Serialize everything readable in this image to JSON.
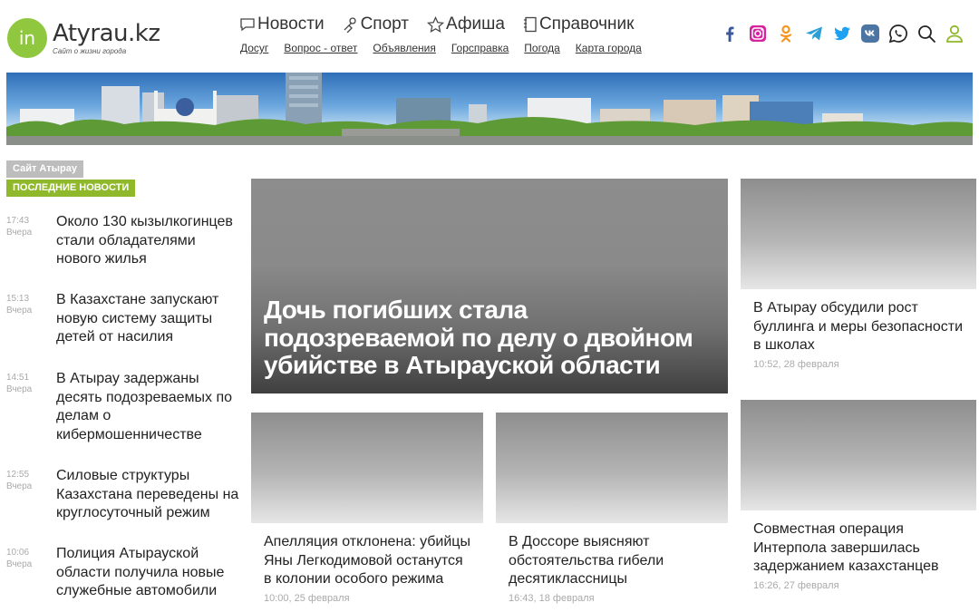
{
  "logo": {
    "mark": "in",
    "name": "Atyrau.kz",
    "tagline": "Сайт о жизни города"
  },
  "nav": {
    "main": [
      {
        "label": "Новости",
        "icon": "chat-bubble-icon"
      },
      {
        "label": "Спорт",
        "icon": "sport-icon"
      },
      {
        "label": "Афиша",
        "icon": "star-icon"
      },
      {
        "label": "Справочник",
        "icon": "notebook-icon"
      }
    ],
    "sub": [
      "Досуг",
      "Вопрос - ответ",
      "Объявления",
      "Горсправка",
      "Погода",
      "Карта города"
    ]
  },
  "social": {
    "colors": {
      "facebook": "#3b5998",
      "instagram": "#d6249f",
      "ok": "#f7931e",
      "telegram": "#2a9fd6",
      "twitter": "#1da1f2",
      "vk": "#4c75a3",
      "whatsapp": "#222222",
      "search": "#222222",
      "user": "#8fb82a"
    }
  },
  "sidebar": {
    "tag_site": "Сайт Атырау",
    "tag_latest": "ПОСЛЕДНИЕ НОВОСТИ",
    "items": [
      {
        "time": "17:43",
        "day": "Вчера",
        "title": "Около 130 кызылкогинцев стали обладателями нового жилья"
      },
      {
        "time": "15:13",
        "day": "Вчера",
        "title": "В Казахстане запускают новую систему защиты детей от насилия"
      },
      {
        "time": "14:51",
        "day": "Вчера",
        "title": "В Атырау задержаны десять подозреваемых по делам о кибермошенничестве"
      },
      {
        "time": "12:55",
        "day": "Вчера",
        "title": "Силовые структуры Казахстана переведены на круглосуточный режим"
      },
      {
        "time": "10:06",
        "day": "Вчера",
        "title": "Полиция Атырауской области получила новые служебные автомобили"
      }
    ]
  },
  "hero": {
    "title": "Дочь погибших стала подозреваемой по делу о двойном убийстве в Атырауской области"
  },
  "cards": [
    {
      "title": "В Атырау обсудили рост буллинга и меры безопасности в школах",
      "date": "10:52, 28 февраля"
    },
    {
      "title": "Апелляция отклонена: убийцы Яны Легкодимовой останутся в колонии особого режима",
      "date": "10:00, 25 февраля"
    },
    {
      "title": "В Доссоре выясняют обстоятельства гибели десятиклассницы",
      "date": "16:43, 18 февраля"
    },
    {
      "title": "Совместная операция Интерпола завершилась задержанием казахстанцев",
      "date": "16:26, 27 февраля"
    }
  ]
}
